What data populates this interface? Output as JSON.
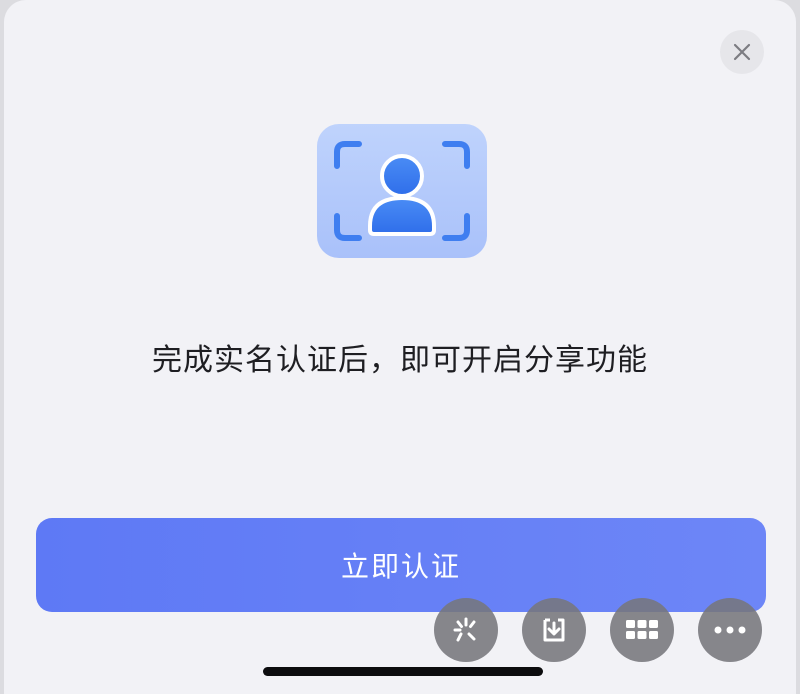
{
  "dialog": {
    "message": "完成实名认证后，即可开启分享功能",
    "primary_button_label": "立即认证",
    "close_icon": "close-icon",
    "illustration_icon": "face-scan-user-icon"
  },
  "floating_toolbar": {
    "items": [
      {
        "icon": "loading-spinner-icon"
      },
      {
        "icon": "download-icon"
      },
      {
        "icon": "grid-icon"
      },
      {
        "icon": "more-icon"
      }
    ]
  },
  "colors": {
    "sheet_background": "#f2f2f6",
    "primary_button": "#6078f5",
    "illustration_bg": "#b7ccfb",
    "illustration_accent": "#3d7cf0"
  }
}
